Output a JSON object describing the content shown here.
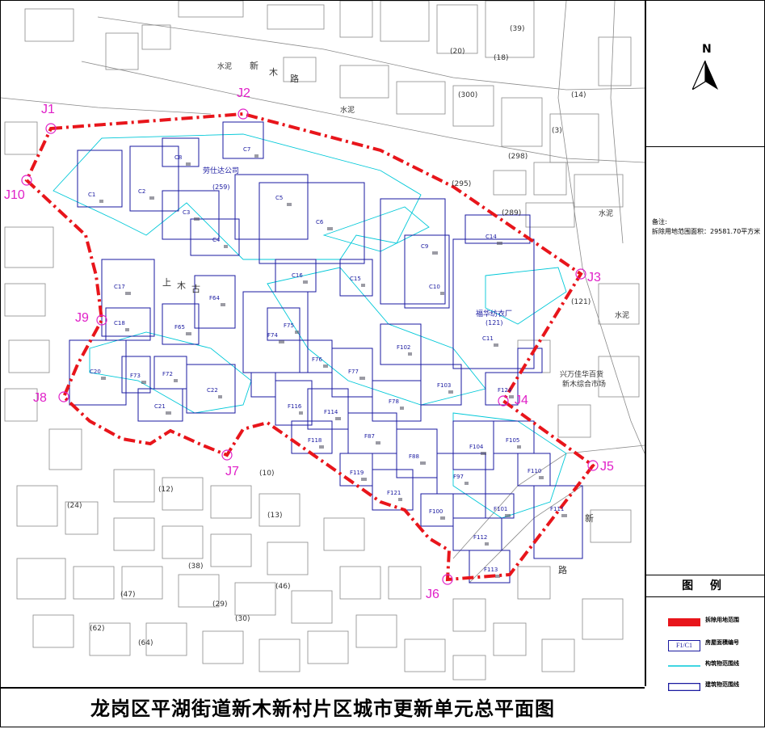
{
  "map": {
    "title": "龙岗区平湖街道新木新村片区城市更新单元总平面图",
    "road_labels": [
      "新",
      "木",
      "路",
      "新",
      "路",
      "水泥",
      "水泥",
      "水泥",
      "水泥"
    ],
    "factory_labels": [
      {
        "name": "劳仕达公司",
        "sub": "(259)"
      },
      {
        "name": "福华纺衣厂",
        "sub": "(121)"
      }
    ],
    "market_labels": [
      "兴万佳华百货",
      "新木综合市场"
    ],
    "place_labels": [
      "上",
      "木",
      "古"
    ],
    "parcel_numbers": [
      "(39)",
      "(20)",
      "(18)",
      "(300)",
      "(14)",
      "(3)",
      "(298)",
      "(295)",
      "(289)",
      "(121)",
      "(24)",
      "(30)",
      "(29)",
      "(62)",
      "(47)",
      "(64)",
      "(46)",
      "(13)",
      "(10)",
      "(38)",
      "(12)"
    ],
    "building_codes": [
      "C1",
      "C2",
      "C3",
      "C4",
      "C5",
      "C6",
      "C7",
      "C8",
      "C9",
      "C10",
      "C11",
      "C14",
      "C15",
      "C16",
      "C17",
      "C18",
      "C20",
      "C21",
      "C22",
      "F64",
      "F65",
      "F72",
      "F73",
      "F74",
      "F75",
      "F76",
      "F77",
      "F78",
      "F87",
      "F88",
      "F97",
      "F100",
      "F101",
      "F102",
      "F103",
      "F104",
      "F105",
      "F110",
      "F111",
      "F112",
      "F113",
      "F114",
      "F116",
      "F118",
      "F119",
      "F121",
      "F124"
    ],
    "boundary_points": [
      {
        "label": "J1"
      },
      {
        "label": "J2"
      },
      {
        "label": "J3"
      },
      {
        "label": "J4"
      },
      {
        "label": "J5"
      },
      {
        "label": "J6"
      },
      {
        "label": "J7"
      },
      {
        "label": "J8"
      },
      {
        "label": "J9"
      },
      {
        "label": "J10"
      }
    ]
  },
  "north": {
    "label": "N"
  },
  "remarks": {
    "title": "备注:",
    "text": "拆除用地范围面积：29581.70平方米"
  },
  "legend": {
    "header": "图 例",
    "items": [
      {
        "name": "demolition-boundary",
        "label": "拆除用地范围",
        "color": "#e8151b"
      },
      {
        "name": "building-number",
        "label": "房屋面積编号",
        "swatch_text": "F1/C1",
        "color": "#1a1aa0"
      },
      {
        "name": "structure-outline",
        "label": "构筑物范围线",
        "color": "#00c8d8"
      },
      {
        "name": "building-outline",
        "label": "建筑物范围线",
        "color": "#1a1aa0"
      }
    ]
  },
  "colors": {
    "boundary": "#e8151b",
    "control_point": "#e020c8",
    "building": "#1a1aa0",
    "structure": "#00c8d8",
    "topo": "#7a7a7a"
  }
}
